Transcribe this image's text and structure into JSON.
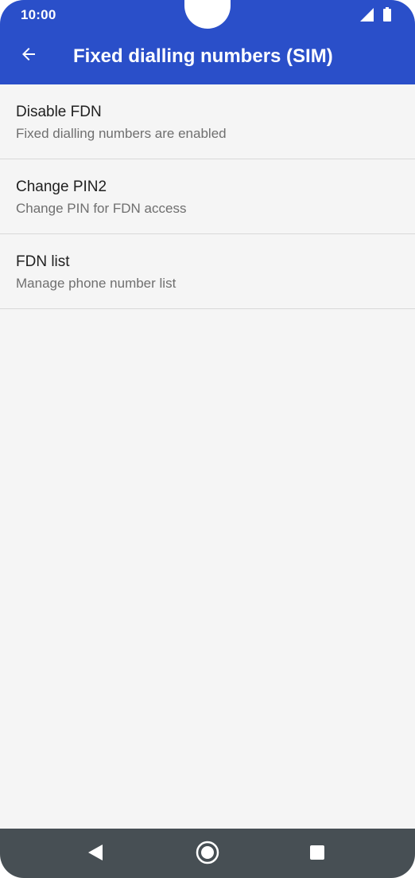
{
  "status_bar": {
    "time": "10:00"
  },
  "app_bar": {
    "title": "Fixed dialling numbers (SIM)",
    "back_icon": "arrow-back-icon"
  },
  "preferences": [
    {
      "title": "Disable FDN",
      "summary": "Fixed dialling numbers are enabled"
    },
    {
      "title": "Change PIN2",
      "summary": "Change PIN for FDN access"
    },
    {
      "title": "FDN list",
      "summary": "Manage phone number list"
    }
  ],
  "navigation_bar": {
    "back_icon": "nav-back-triangle-icon",
    "home_icon": "nav-home-circle-icon",
    "recents_icon": "nav-recents-square-icon"
  },
  "colors": {
    "primary": "#2a4fc9",
    "background": "#f5f5f5",
    "navbar": "#474f54"
  }
}
